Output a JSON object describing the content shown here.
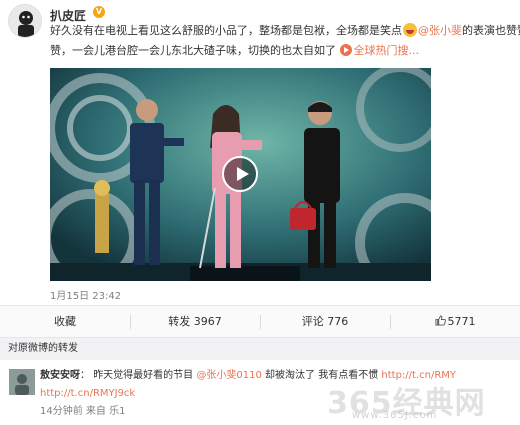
{
  "post": {
    "username": "扒皮匠",
    "verified_badge": "V",
    "text_line1_a": "好久没有在电视上看见这么舒服的小品了，整场都是包袱，全场都是笑点",
    "text_line1_mention": "@张小斐",
    "text_line1_b": "的表演也赞赞",
    "text_line2_a": "赞，一会儿港台腔一会儿东北大碴子味，切换的也太自如了",
    "link_text": "全球热门搜...",
    "timestamp": "1月15日 23:42"
  },
  "actions": {
    "favorite": "收藏",
    "repost": "转发 3967",
    "comment": "评论 776",
    "like": "5771"
  },
  "repost_section": {
    "title": "对原微博的转发"
  },
  "comment": {
    "user": "敖安安呀",
    "colon": "：",
    "text_a": "昨天觉得最好看的节目",
    "mention": "@张小斐0110",
    "text_b": "却被淘汰了 我有点看不惯",
    "url_partial": "http://t.cn/RMY",
    "url_line2": "http://t.cn/RMYJ9ck",
    "meta": "14分钟前 来自 乐1"
  },
  "watermark": {
    "logo": "365经典网",
    "url": "www.365J.com"
  },
  "colors": {
    "accent": "#eb7350",
    "badge": "#f7a415"
  },
  "icons": [
    "avatar",
    "verified-badge",
    "laugh-emoji-icon",
    "link-play-icon",
    "play-icon",
    "thumbs-up-icon"
  ]
}
